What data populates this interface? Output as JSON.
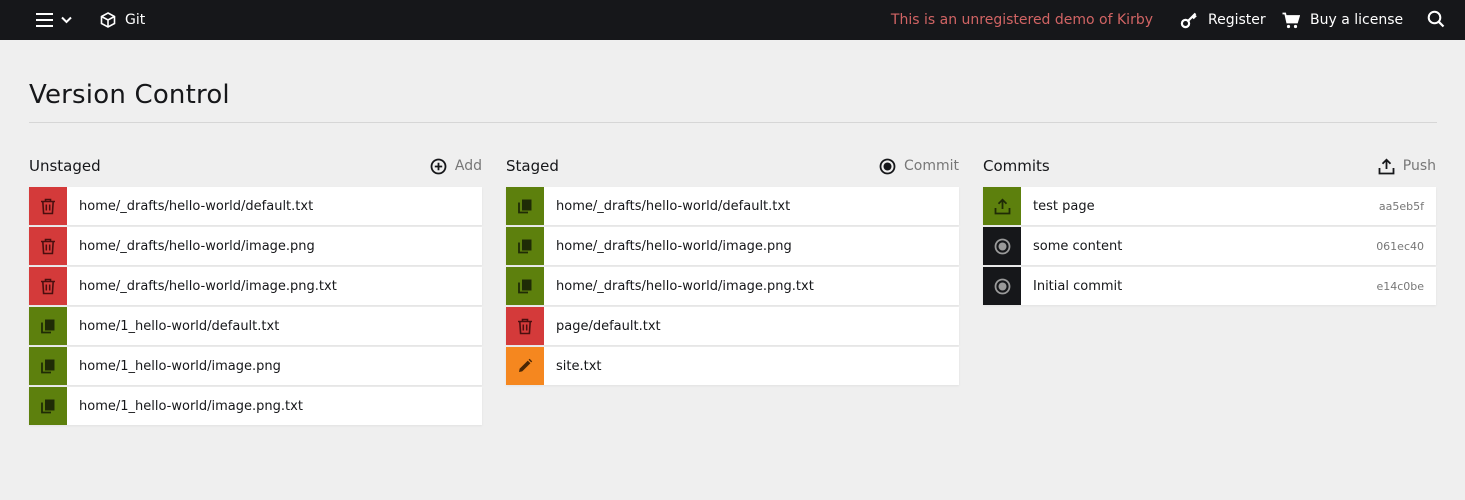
{
  "topbar": {
    "breadcrumb": "Git",
    "demo_notice": "This is an unregistered demo of Kirby",
    "register": "Register",
    "buy_license": "Buy a license"
  },
  "page": {
    "title": "Version Control"
  },
  "colors": {
    "deleted": "#d43a3a",
    "added": "#5d800d",
    "modified": "#f5871f",
    "commit": "#16171a"
  },
  "unstaged": {
    "title": "Unstaged",
    "action": "Add",
    "items": [
      {
        "path": "home/_drafts/hello-world/default.txt",
        "status": "deleted",
        "icon": "trash-icon"
      },
      {
        "path": "home/_drafts/hello-world/image.png",
        "status": "deleted",
        "icon": "trash-icon"
      },
      {
        "path": "home/_drafts/hello-world/image.png.txt",
        "status": "deleted",
        "icon": "trash-icon"
      },
      {
        "path": "home/1_hello-world/default.txt",
        "status": "added",
        "icon": "copy-icon"
      },
      {
        "path": "home/1_hello-world/image.png",
        "status": "added",
        "icon": "copy-icon"
      },
      {
        "path": "home/1_hello-world/image.png.txt",
        "status": "added",
        "icon": "copy-icon"
      }
    ]
  },
  "staged": {
    "title": "Staged",
    "action": "Commit",
    "items": [
      {
        "path": "home/_drafts/hello-world/default.txt",
        "status": "added",
        "icon": "copy-icon"
      },
      {
        "path": "home/_drafts/hello-world/image.png",
        "status": "added",
        "icon": "copy-icon"
      },
      {
        "path": "home/_drafts/hello-world/image.png.txt",
        "status": "added",
        "icon": "copy-icon"
      },
      {
        "path": "page/default.txt",
        "status": "deleted",
        "icon": "trash-icon"
      },
      {
        "path": "site.txt",
        "status": "modified",
        "icon": "pencil-icon"
      }
    ]
  },
  "commits": {
    "title": "Commits",
    "action": "Push",
    "items": [
      {
        "message": "test page",
        "hash": "aa5eb5f",
        "status": "unpushed",
        "icon": "upload-icon"
      },
      {
        "message": "some content",
        "hash": "061ec40",
        "status": "pushed",
        "icon": "commit-icon"
      },
      {
        "message": "Initial commit",
        "hash": "e14c0be",
        "status": "pushed",
        "icon": "commit-icon"
      }
    ]
  }
}
